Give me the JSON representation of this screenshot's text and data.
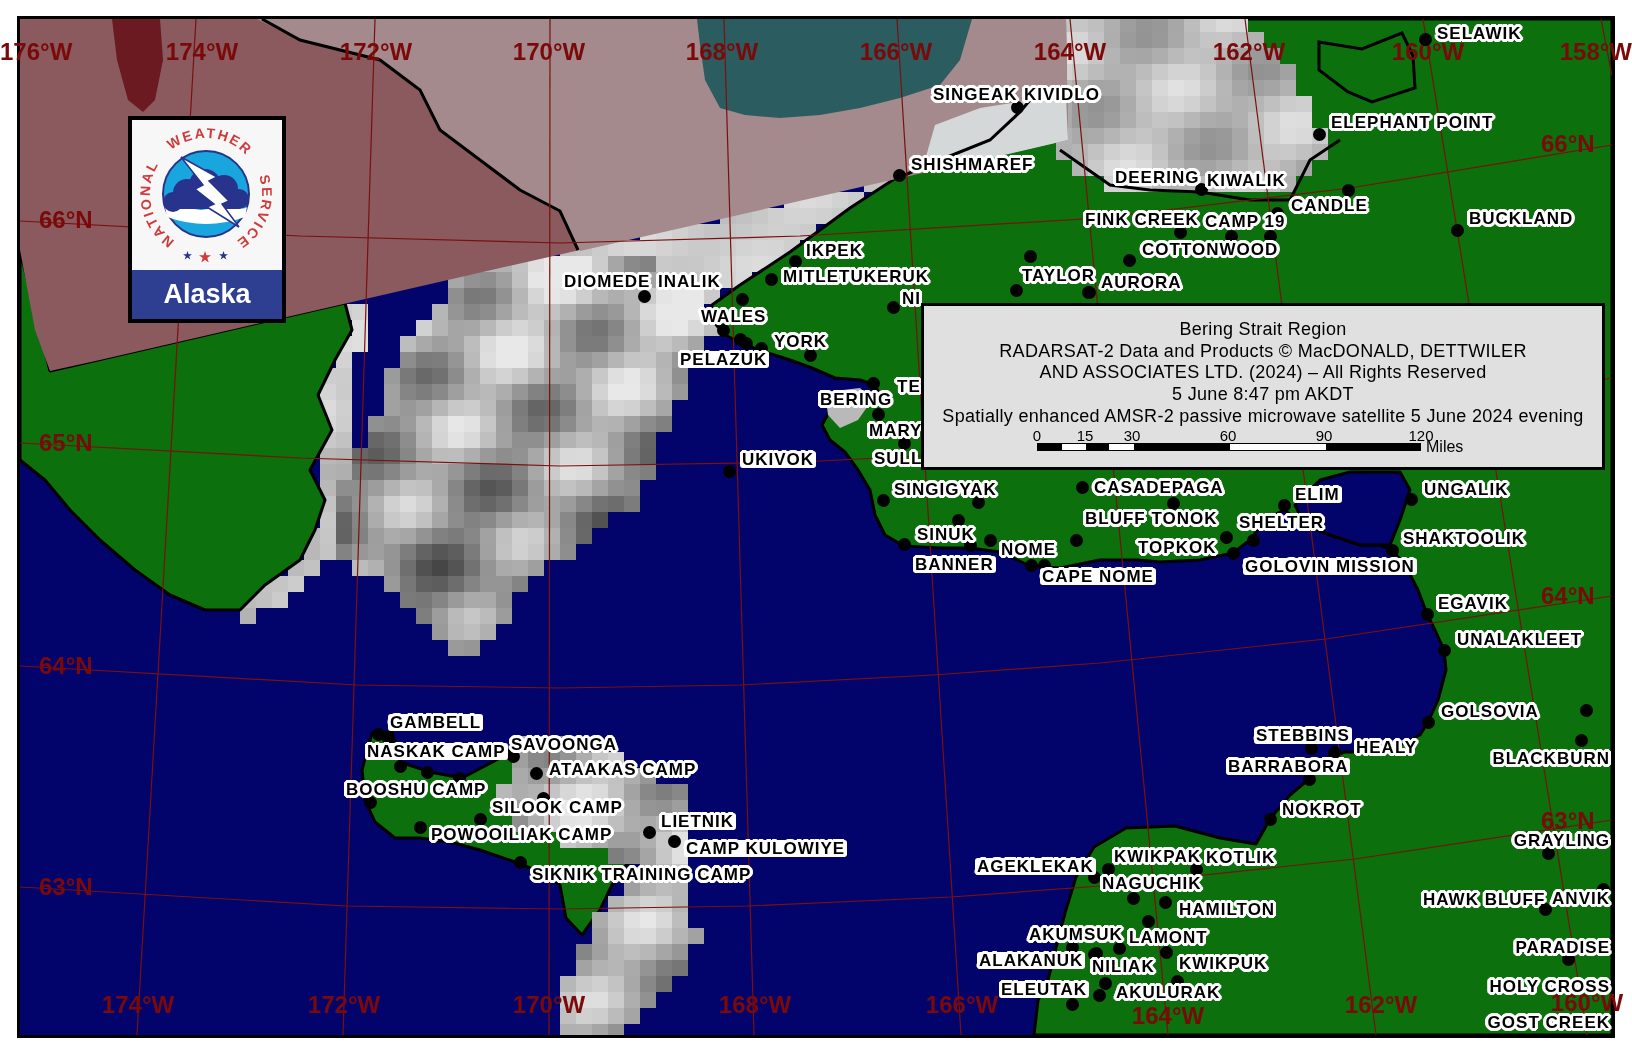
{
  "map_labels": {
    "longitudes_top": [
      "176°W",
      "174°W",
      "172°W",
      "170°W",
      "168°W",
      "166°W",
      "164°W",
      "162°W",
      "160°W",
      "158°W"
    ],
    "latitudes_left": [
      "66°N",
      "65°N",
      "64°N",
      "63°N"
    ],
    "latitudes_right": [
      "66°N",
      "64°N",
      "63°N"
    ],
    "longitudes_bottom": [
      "174°W",
      "172°W",
      "170°W",
      "168°W",
      "166°W",
      "164°W",
      "162°W",
      "160°W"
    ]
  },
  "logo": {
    "ring_words": [
      "NATIONAL",
      "WEATHER",
      "SERVICE"
    ],
    "region": "Alaska"
  },
  "places": [
    "SELAWIK",
    "SINGEAK",
    "KIVIDLO",
    "ELEPHANT POINT",
    "SHISHMAREF",
    "DEERING",
    "KIWALIK",
    "CANDLE",
    "FINK CREEK",
    "CAMP 19",
    "BUCKLAND",
    "IKPEK",
    "COTTONWOOD",
    "DIOMEDE",
    "INALIK",
    "MITLETUKERUK",
    "TAYLOR",
    "AURORA",
    "NI",
    "WALES",
    "YORK",
    "PELAZUK",
    "TE",
    "BERING",
    "MARY",
    "UKIVOK",
    "SULL",
    "SINGIGYAK",
    "CASADEPAGA",
    "ELIM",
    "UNGALIK",
    "BLUFF TONOK",
    "SHELTER",
    "SINUK",
    "SHAKTOOLIK",
    "NOME",
    "TOPKOK",
    "BANNER",
    "GOLOVIN MISSION",
    "CAPE NOME",
    "EGAVIK",
    "UNALAKLEET",
    "GOLSOVIA",
    "GAMBELL",
    "STEBBINS",
    "NASKAK CAMP",
    "SAVOONGA",
    "HEALY",
    "BLACKBURN",
    "ATAAKAS CAMP",
    "BARRABORA",
    "BOOSHU CAMP",
    "SILOOK CAMP",
    "NOKROT",
    "LIETNIK",
    "POWOOILIAK CAMP",
    "GRAYLING",
    "CAMP KULOWIYE",
    "KWIKPAK",
    "KOTLIK",
    "AGEKLEKAK",
    "SIKNIK TRAINING CAMP",
    "NAGUCHIK",
    "HAWK BLUFF",
    "ANVIK",
    "HAMILTON",
    "AKUMSUK",
    "LAMONT",
    "PARADISE",
    "ALAKANUK",
    "NILIAK",
    "KWIKPUK",
    "ELEUTAK",
    "AKULURAK",
    "HOLY CROSS",
    "GOST CREEK"
  ],
  "legend": {
    "title": "Bering Strait Region",
    "lines": [
      "RADARSAT-2 Data and Products © MacDONALD, DETTWILER",
      "AND ASSOCIATES LTD. (2024) – All Rights Reserved",
      "5 June 8:47 pm AKDT",
      "Spatially enhanced AMSR-2 passive microwave satellite 5 June 2024 evening"
    ],
    "scale": {
      "ticks": [
        "0",
        "15",
        "30",
        "60",
        "90",
        "120"
      ],
      "unit": "Miles"
    }
  }
}
